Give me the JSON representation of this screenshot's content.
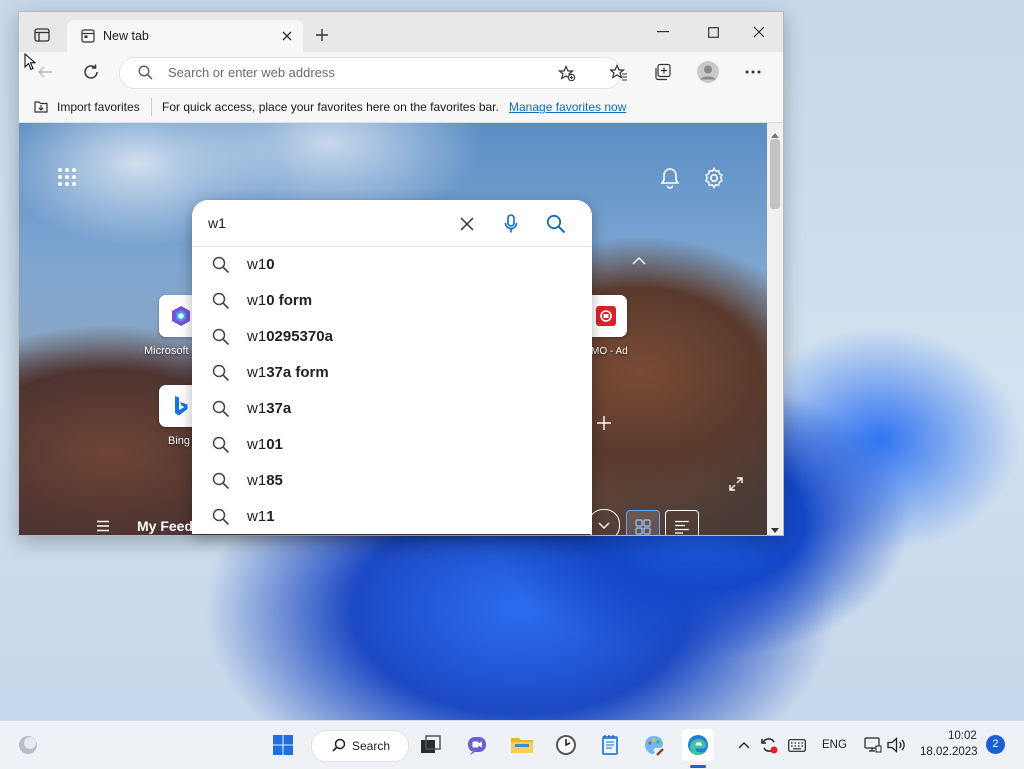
{
  "browser": {
    "tab_title": "New tab",
    "address_placeholder": "Search or enter web address",
    "favorites_bar": {
      "import_label": "Import favorites",
      "hint": "For quick access, place your favorites here on the favorites bar.",
      "manage_link": "Manage favorites now"
    }
  },
  "newtab": {
    "tiles": [
      {
        "label": "Microsoft",
        "icon": "copilot-icon"
      },
      {
        "label": "Bing",
        "icon": "bing-icon"
      },
      {
        "label": "MO - Ad",
        "icon": "ad-site-icon"
      }
    ],
    "my_feed_label": "My Feed"
  },
  "search": {
    "query": "w1",
    "suggestions": [
      {
        "typed": "w1",
        "completion": "0"
      },
      {
        "typed": "w1",
        "completion": "0 form"
      },
      {
        "typed": "w1",
        "completion": "0295370a"
      },
      {
        "typed": "w1",
        "completion": "37a form"
      },
      {
        "typed": "w1",
        "completion": "37a"
      },
      {
        "typed": "w1",
        "completion": "01"
      },
      {
        "typed": "w1",
        "completion": "85"
      },
      {
        "typed": "w1",
        "completion": "1"
      }
    ]
  },
  "taskbar": {
    "search_label": "Search",
    "language": "ENG",
    "time": "10:02",
    "date": "18.02.2023",
    "notification_count": "2"
  },
  "colors": {
    "accent": "#0f6cbd",
    "taskbar_bg": "#eef1f5",
    "badge": "#1a5fd6"
  }
}
